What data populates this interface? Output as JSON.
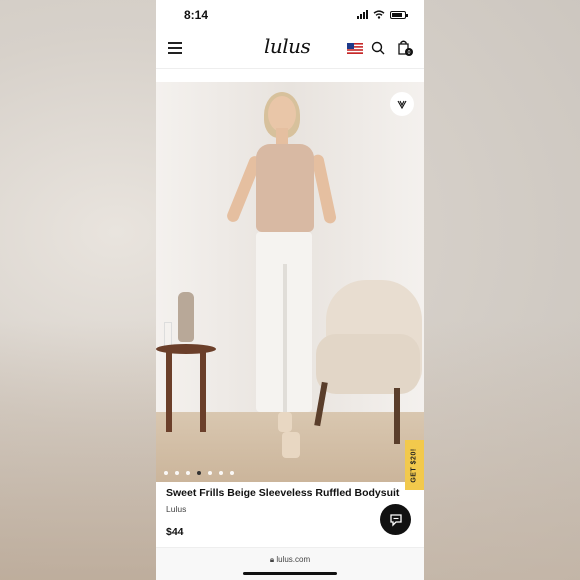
{
  "status_bar": {
    "time": "8:14"
  },
  "nav": {
    "logo": "lulus",
    "bag_count": "0"
  },
  "hero": {
    "dots_total": 7,
    "dots_active_index": 3
  },
  "promo": {
    "label": "GET $20!"
  },
  "product": {
    "title": "Sweet Frills Beige Sleeveless Ruffled Bodysuit",
    "brand": "Lulus",
    "price": "$44"
  },
  "browser": {
    "url": "lulus.com"
  },
  "colors": {
    "promo_bg": "#f2c94c",
    "chat_bg": "#111111",
    "text_primary": "#111111"
  }
}
